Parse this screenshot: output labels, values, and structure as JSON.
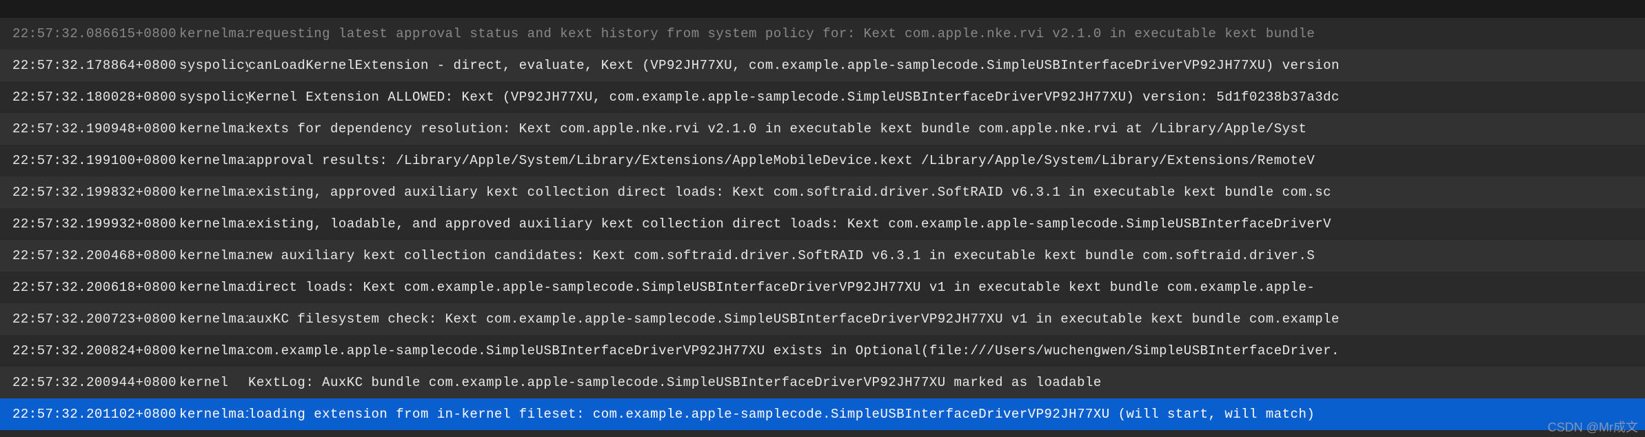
{
  "logs": [
    {
      "time": "22:57:32.086615+0800",
      "process": "kernelmai",
      "message": "requesting latest approval status and kext history from system policy for:  Kext com.apple.nke.rvi v2.1.0 in executable kext bundle",
      "rowClass": "dim"
    },
    {
      "time": "22:57:32.178864+0800",
      "process": "syspolicy",
      "message": "canLoadKernelExtension - direct, evaluate, Kext (VP92JH77XU, com.example.apple-samplecode.SimpleUSBInterfaceDriverVP92JH77XU) version",
      "rowClass": "odd"
    },
    {
      "time": "22:57:32.180028+0800",
      "process": "syspolicy",
      "message": "Kernel Extension ALLOWED: Kext (VP92JH77XU, com.example.apple-samplecode.SimpleUSBInterfaceDriverVP92JH77XU) version: 5d1f0238b37a3dc",
      "rowClass": "even"
    },
    {
      "time": "22:57:32.190948+0800",
      "process": "kernelmai",
      "message": "kexts for dependency resolution:    Kext com.apple.nke.rvi v2.1.0 in executable kext bundle com.apple.nke.rvi at /Library/Apple/Syst",
      "rowClass": "odd"
    },
    {
      "time": "22:57:32.199100+0800",
      "process": "kernelmai",
      "message": "approval results:   /Library/Apple/System/Library/Extensions/AppleMobileDevice.kext /Library/Apple/System/Library/Extensions/RemoteV",
      "rowClass": "even"
    },
    {
      "time": "22:57:32.199832+0800",
      "process": "kernelmai",
      "message": "existing, approved auxiliary kext collection direct loads:  Kext com.softraid.driver.SoftRAID v6.3.1 in executable kext bundle com.sc",
      "rowClass": "odd"
    },
    {
      "time": "22:57:32.199932+0800",
      "process": "kernelmai",
      "message": "existing, loadable, and approved auxiliary kext collection direct loads:  Kext com.example.apple-samplecode.SimpleUSBInterfaceDriverV",
      "rowClass": "even"
    },
    {
      "time": "22:57:32.200468+0800",
      "process": "kernelmai",
      "message": "new auxiliary kext collection candidates:    Kext com.softraid.driver.SoftRAID v6.3.1 in executable kext bundle com.softraid.driver.S",
      "rowClass": "odd"
    },
    {
      "time": "22:57:32.200618+0800",
      "process": "kernelmai",
      "message": "direct loads:   Kext com.example.apple-samplecode.SimpleUSBInterfaceDriverVP92JH77XU v1 in executable kext bundle com.example.apple-",
      "rowClass": "even"
    },
    {
      "time": "22:57:32.200723+0800",
      "process": "kernelmai",
      "message": "auxKC filesystem check: Kext com.example.apple-samplecode.SimpleUSBInterfaceDriverVP92JH77XU v1 in executable kext bundle com.example",
      "rowClass": "odd"
    },
    {
      "time": "22:57:32.200824+0800",
      "process": "kernelmai",
      "message": "com.example.apple-samplecode.SimpleUSBInterfaceDriverVP92JH77XU exists in Optional(file:///Users/wuchengwen/SimpleUSBInterfaceDriver.",
      "rowClass": "even"
    },
    {
      "time": "22:57:32.200944+0800",
      "process": "kernel",
      "message": "KextLog: AuxKC bundle com.example.apple-samplecode.SimpleUSBInterfaceDriverVP92JH77XU marked as loadable",
      "rowClass": "odd"
    },
    {
      "time": "22:57:32.201102+0800",
      "process": "kernelmai",
      "message": "loading extension from in-kernel fileset: com.example.apple-samplecode.SimpleUSBInterfaceDriverVP92JH77XU (will start, will match)",
      "rowClass": "selected"
    }
  ],
  "watermark": "CSDN @Mr成文"
}
